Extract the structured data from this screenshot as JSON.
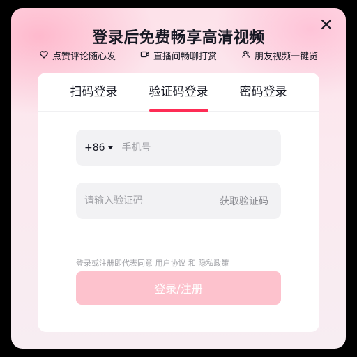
{
  "header": {
    "title": "登录后免费畅享高清视频",
    "features": [
      {
        "icon": "heart-icon",
        "label": "点赞评论随心发"
      },
      {
        "icon": "video-camera-icon",
        "label": "直播间畅聊打赏"
      },
      {
        "icon": "friends-icon",
        "label": "朋友视频一键览"
      }
    ]
  },
  "tabs": [
    {
      "label": "扫码登录",
      "active": false
    },
    {
      "label": "验证码登录",
      "active": true
    },
    {
      "label": "密码登录",
      "active": false
    }
  ],
  "form": {
    "country_code": "+86",
    "phone_placeholder": "手机号",
    "code_placeholder": "请输入验证码",
    "get_code_label": "获取验证码",
    "error_text": "",
    "agreement_prefix": "登录或注册即代表同意",
    "user_agreement": "用户协议",
    "and_text": "和",
    "privacy_policy": "隐私政策",
    "submit_label": "登录/注册"
  },
  "colors": {
    "accent": "#fe2c55",
    "submit_disabled": "#fdc2cd",
    "text_primary": "#161823",
    "placeholder": "#a1a2a7"
  }
}
